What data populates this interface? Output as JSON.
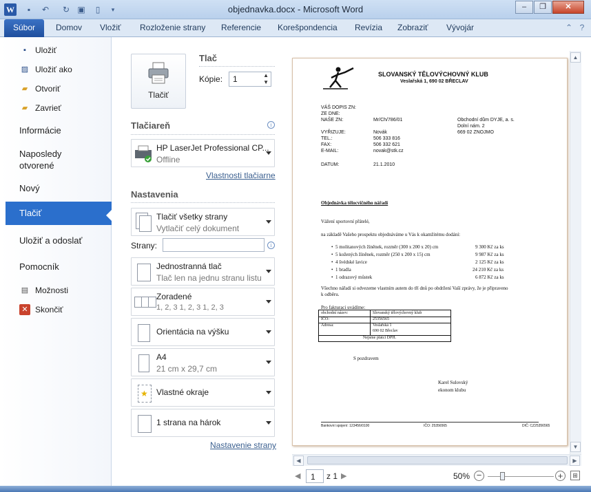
{
  "window": {
    "title": "objednavka.docx - Microsoft Word",
    "app_icon": "W"
  },
  "ribbon": {
    "file_tab": "Súbor",
    "tabs": [
      "Domov",
      "Vložiť",
      "Rozloženie strany",
      "Referencie",
      "Korešpondencia",
      "Revízia",
      "Zobraziť",
      "Vývojár"
    ]
  },
  "nav": {
    "save": "Uložiť",
    "save_as": "Uložiť ako",
    "open": "Otvoriť",
    "close": "Zavrieť",
    "info": "Informácie",
    "recent_line1": "Naposledy",
    "recent_line2": "otvorené",
    "new": "Nový",
    "print": "Tlačiť",
    "save_send": "Uložiť a odoslať",
    "help": "Pomocník",
    "options": "Možnosti",
    "exit": "Skončiť"
  },
  "print": {
    "print_button": "Tlačiť",
    "section_title": "Tlač",
    "copies_label": "Kópie:",
    "copies_value": "1",
    "printer_section": "Tlačiareň",
    "printer_name": "HP LaserJet Professional CP...",
    "printer_status": "Offline",
    "printer_properties": "Vlastnosti tlačiarne",
    "settings_section": "Nastavenia",
    "pages_label": "Strany:",
    "pages_value": "",
    "page_setup_link": "Nastavenie strany",
    "settings": [
      {
        "title": "Tlačiť všetky strany",
        "sub": "Vytlačiť celý dokument"
      },
      {
        "title": "Jednostranná tlač",
        "sub": "Tlač len na jednu stranu listu"
      },
      {
        "title": "Zoradené",
        "sub": "1, 2, 3    1, 2, 3    1, 2, 3"
      },
      {
        "title": "Orientácia na výšku",
        "sub": ""
      },
      {
        "title": "A4",
        "sub": "21 cm x 29,7 cm"
      },
      {
        "title": "Vlastné okraje",
        "sub": ""
      },
      {
        "title": "1 strana na hárok",
        "sub": ""
      }
    ]
  },
  "document": {
    "club_name": "SLOVANSKÝ TĚLOVÝCHOVNÝ KLUB",
    "club_address": "Veslařská 1,  690 02  BŘECLAV",
    "labels": [
      "VÁŠ DOPIS ZN:",
      "ZE DNE:",
      "NAŠE ZN:",
      "VYŘIZUJE:",
      "TEL.:",
      "FAX:",
      "E-MAIL:",
      "DATUM:"
    ],
    "nase_zn": "Mr/Ch/786/01",
    "vyrizuje": "Novák",
    "tel": "506  333 816",
    "fax": "506  332 621",
    "email": "novak@stk.cz",
    "datum": "21.1.2010",
    "recipient": [
      "Obchodní  dům  DYJE, a. s.",
      "Dolní nám.  2",
      "669  02  ZNOJMO"
    ],
    "subject": "Objednávka tělocvičného nářadí",
    "greeting": "Vážení sportovní přátelé,",
    "intro": "na základě Vašeho prospektu objednáváme u Vás k okamžitému dodání:",
    "items": [
      {
        "text": "5 molitanových žíněnek, rozměr (300 x 200 x 20) cm",
        "price": "9 300 Kč za ks"
      },
      {
        "text": "5 kožených žíněnek, rozměr (250 x 200 x 15) cm",
        "price": "9 987 Kč za ks"
      },
      {
        "text": "4 švédské lavice",
        "price": "2 125 Kč za ks"
      },
      {
        "text": "1 bradla",
        "price": "24 210 Kč za ks"
      },
      {
        "text": "1 odrazový můstek",
        "price": "6 872 Kč za ks"
      }
    ],
    "delivery_line1": "Všechno nářadí si odvezeme vlastním autem do tří dnů po obdržení Vaší zprávy, že je připraveno",
    "delivery_line2": "k odběru.",
    "billing_intro": "Pro fakturaci uvádíme:",
    "billing_table": {
      "name_label": "obchodní název:",
      "name_value": "Slovanský tělovýchovný klub",
      "ico_label": "IČO:",
      "ico_value": "25356565",
      "address_label": "Adresa:",
      "address_line1": "Veslařská 1",
      "address_line2": "690 02 Břeclav",
      "dph": "Nejsme plátci DPH."
    },
    "closing": "S pozdravem",
    "signature_name": "Karel Sulovský",
    "signature_title": "ekonom klubu",
    "footer_left": "Bankovní spojení: 123456/0100",
    "footer_mid": "IČO: 25356565",
    "footer_right": "DIČ: CZ25356565"
  },
  "status": {
    "page_current": "1",
    "page_total": "z 1",
    "zoom": "50%",
    "zoom_level_percent": 50
  }
}
